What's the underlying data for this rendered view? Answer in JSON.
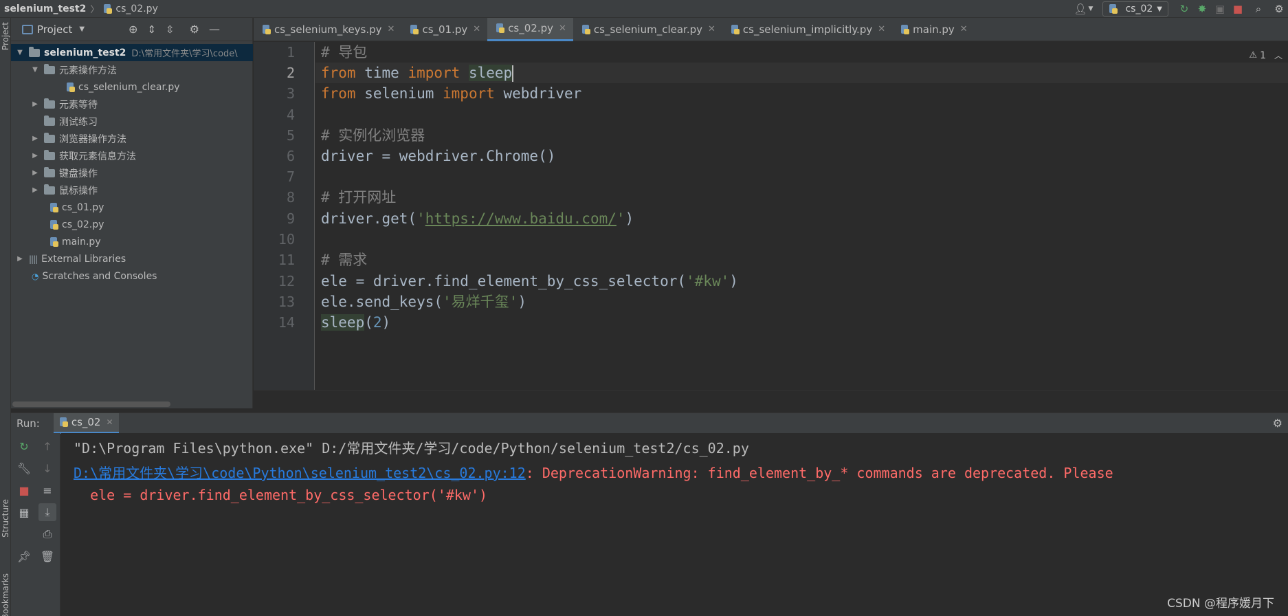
{
  "breadcrumb": {
    "project": "selenium_test2",
    "file": "cs_02.py"
  },
  "toolbar": {
    "run_config": "cs_02"
  },
  "left_stripe": {
    "project_label": "Project",
    "structure_label": "Structure",
    "bookmarks_label": "Bookmarks"
  },
  "project_panel": {
    "title": "Project",
    "root": {
      "name": "selenium_test2",
      "path": "D:\\常用文件夹\\学习\\code\\"
    },
    "items": [
      {
        "label": "元素操作方法"
      },
      {
        "label": "cs_selenium_clear.py"
      },
      {
        "label": "元素等待"
      },
      {
        "label": "测试练习"
      },
      {
        "label": "浏览器操作方法"
      },
      {
        "label": "获取元素信息方法"
      },
      {
        "label": "键盘操作"
      },
      {
        "label": "鼠标操作"
      },
      {
        "label": "cs_01.py"
      },
      {
        "label": "cs_02.py"
      },
      {
        "label": "main.py"
      },
      {
        "label": "External Libraries"
      },
      {
        "label": "Scratches and Consoles"
      }
    ]
  },
  "editor_tabs": [
    {
      "label": "cs_selenium_keys.py"
    },
    {
      "label": "cs_01.py"
    },
    {
      "label": "cs_02.py"
    },
    {
      "label": "cs_selenium_clear.py"
    },
    {
      "label": "cs_selenium_implicitly.py"
    },
    {
      "label": "main.py"
    }
  ],
  "editor": {
    "warning_count": "1",
    "line_numbers": [
      "1",
      "2",
      "3",
      "4",
      "5",
      "6",
      "7",
      "8",
      "9",
      "10",
      "11",
      "12",
      "13",
      "14"
    ],
    "code": {
      "l1": "# 导包",
      "l2_kw1": "from",
      "l2_mod": " time ",
      "l2_kw2": "import",
      "l2_name": "sleep",
      "l3_kw1": "from",
      "l3_mod": " selenium ",
      "l3_kw2": "import",
      "l3_name": " webdriver",
      "l5": "# 实例化浏览器",
      "l6": "driver = webdriver.Chrome()",
      "l8": "# 打开网址",
      "l9_a": "driver.get(",
      "l9_q1": "'",
      "l9_url": "https://www.baidu.com/",
      "l9_q2": "'",
      "l9_b": ")",
      "l11": "# 需求",
      "l12_a": "ele = driver.find_element_by_css_selector(",
      "l12_s": "'#kw'",
      "l12_b": ")",
      "l13_a": "ele.send_keys(",
      "l13_s": "'易烊千玺'",
      "l13_b": ")",
      "l14_a": "sleep",
      "l14_b": "(",
      "l14_n": "2",
      "l14_c": ")"
    }
  },
  "run_panel": {
    "label": "Run:",
    "tab": "cs_02",
    "console": {
      "line1": "\"D:\\Program Files\\python.exe\" D:/常用文件夹/学习/code/Python/selenium_test2/cs_02.py",
      "line2_link": "D:\\常用文件夹\\学习\\code\\Python\\selenium_test2\\cs_02.py:12",
      "line2_msg": ": DeprecationWarning: find_element_by_* commands are deprecated. Please",
      "line3": "  ele = driver.find_element_by_css_selector('#kw')"
    }
  },
  "watermark": "CSDN @程序媛月下",
  "colors": {
    "accent": "#4a88c7",
    "keyword": "#cc7832",
    "string": "#6a8759",
    "comment": "#808080",
    "error": "#ff6b68",
    "link": "#287bde"
  },
  "icons": [
    "user-icon",
    "rerun-icon",
    "debug-icon",
    "coverage-icon",
    "stop-icon",
    "search-icon",
    "settings-icon",
    "locate-icon",
    "expand-all-icon",
    "collapse-all-icon",
    "gear-icon",
    "minimize-icon"
  ]
}
